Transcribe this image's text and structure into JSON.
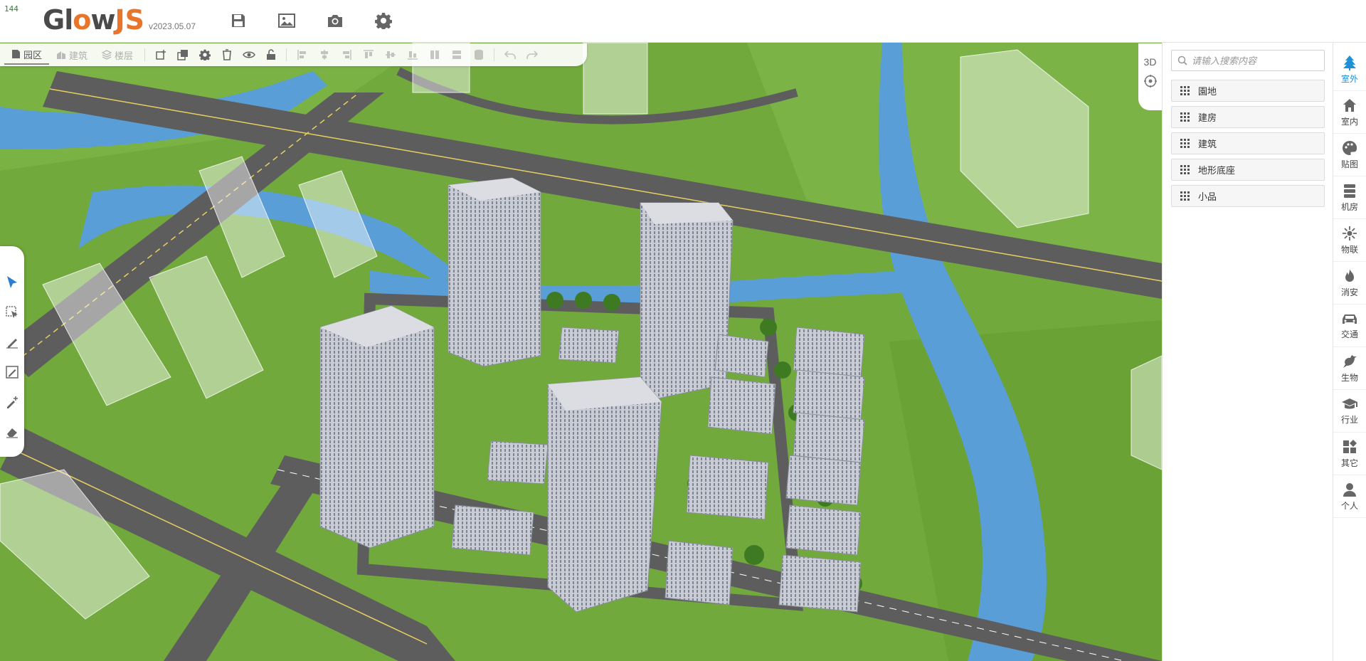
{
  "fps": "144",
  "app": {
    "logo_main": "Gl",
    "logo_o": "o",
    "logo_w": "w",
    "logo_js": "JS",
    "version": "v2023.05.07"
  },
  "header_tools": [
    {
      "name": "save-icon"
    },
    {
      "name": "image-icon"
    },
    {
      "name": "camera-icon"
    },
    {
      "name": "gear-icon"
    }
  ],
  "toolbar2": {
    "tabs": [
      {
        "label": "园区",
        "icon": "document-icon",
        "active": true
      },
      {
        "label": "建筑",
        "icon": "building-icon",
        "active": false
      },
      {
        "label": "楼层",
        "icon": "layers-icon",
        "active": false
      }
    ]
  },
  "viewport": {
    "mode_label": "3D"
  },
  "search": {
    "placeholder": "请输入搜索内容"
  },
  "categories": [
    {
      "label": "園地"
    },
    {
      "label": "建房"
    },
    {
      "label": "建筑"
    },
    {
      "label": "地形底座"
    },
    {
      "label": "小品"
    }
  ],
  "vnav": [
    {
      "label": "室外",
      "icon": "tree-icon",
      "active": true
    },
    {
      "label": "室内",
      "icon": "home-icon",
      "active": false
    },
    {
      "label": "贴图",
      "icon": "palette-icon",
      "active": false
    },
    {
      "label": "机房",
      "icon": "server-icon",
      "active": false
    },
    {
      "label": "物联",
      "icon": "iot-icon",
      "active": false
    },
    {
      "label": "消安",
      "icon": "fire-icon",
      "active": false
    },
    {
      "label": "交通",
      "icon": "car-icon",
      "active": false
    },
    {
      "label": "生物",
      "icon": "bird-icon",
      "active": false
    },
    {
      "label": "行业",
      "icon": "graduation-cap-icon",
      "active": false
    },
    {
      "label": "其它",
      "icon": "widgets-icon",
      "active": false
    },
    {
      "label": "个人",
      "icon": "user-icon",
      "active": false
    }
  ],
  "colors": {
    "accent": "#1f8fd6",
    "logo_orange": "#e8752a",
    "grass": "#6fa53a",
    "water": "#5a9ed8",
    "road": "#5d5d5d"
  }
}
